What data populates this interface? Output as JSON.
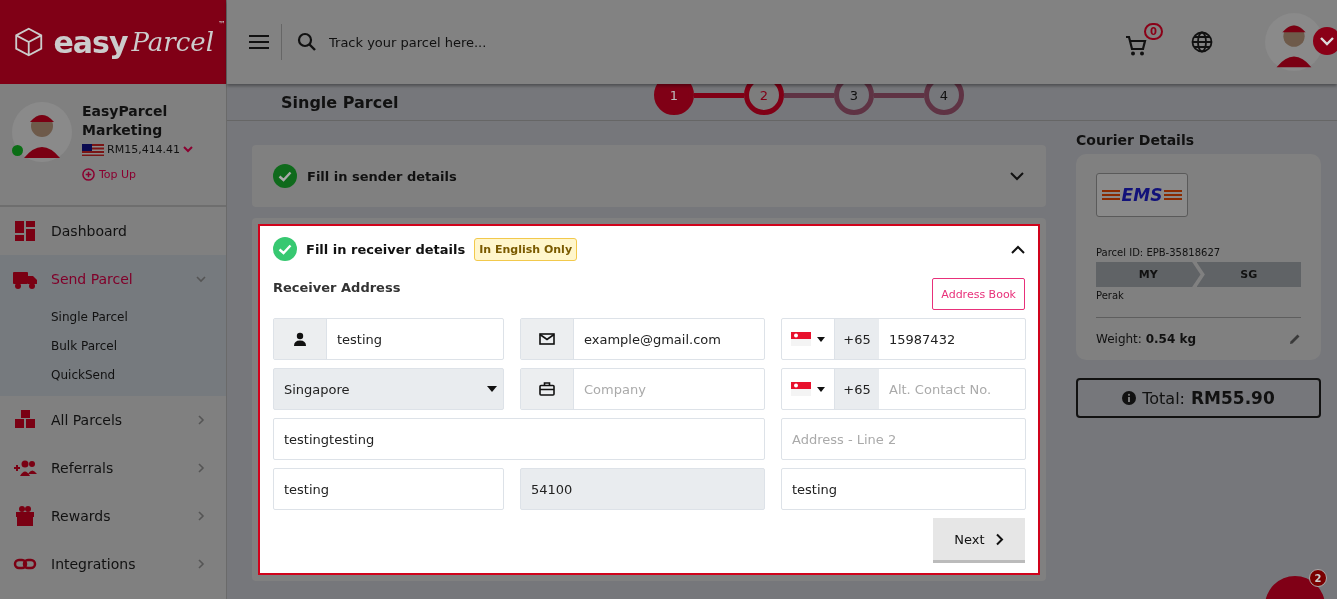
{
  "logo": {
    "word1": "easy",
    "word2": "Parcel",
    "tm": "™"
  },
  "topbar": {
    "search_placeholder": "Track your parcel here...",
    "cart_count": "0"
  },
  "user": {
    "name": "EasyParcel Marketing",
    "balance": "RM15,414.41",
    "online": true,
    "top_up": "Top Up"
  },
  "sidebar": [
    {
      "label": "Dashboard",
      "kind": "dashboard",
      "selected": false
    },
    {
      "label": "Send Parcel",
      "kind": "truck",
      "selected": true,
      "expanded": true,
      "children": [
        {
          "label": "Single Parcel"
        },
        {
          "label": "Bulk Parcel"
        },
        {
          "label": "QuickSend"
        }
      ]
    },
    {
      "label": "All Parcels",
      "kind": "boxes",
      "selected": false,
      "expanded": false
    },
    {
      "label": "Referrals",
      "kind": "people",
      "selected": false,
      "expanded": false
    },
    {
      "label": "Rewards",
      "kind": "gift",
      "selected": false,
      "expanded": false
    },
    {
      "label": "Integrations",
      "kind": "link",
      "selected": false,
      "expanded": false
    }
  ],
  "page": {
    "title": "Single Parcel",
    "steps": [
      {
        "label": "1",
        "completed": true,
        "selected": false
      },
      {
        "label": "2",
        "completed": false,
        "selected": true
      },
      {
        "label": "3",
        "completed": false,
        "selected": false
      },
      {
        "label": "4",
        "completed": false,
        "selected": false
      }
    ]
  },
  "sections": [
    {
      "title": "Fill in sender details",
      "completed": true,
      "expanded": false
    },
    {
      "title": "Fill in receiver details",
      "completed": true,
      "expanded": true,
      "badge": "In English Only",
      "subtitle": "Receiver Address",
      "address_book": "Address Book",
      "next": "Next",
      "rows": [
        [
          {
            "kind": "name",
            "value": "testing",
            "disabled": false
          },
          {
            "kind": "email",
            "value": "example@gmail.com",
            "disabled": false
          },
          {
            "kind": "phone",
            "code": "+65",
            "value": "15987432",
            "disabled": false
          }
        ],
        [
          {
            "kind": "country",
            "value": "Singapore"
          },
          {
            "kind": "company",
            "placeholder": "Company",
            "disabled": false
          },
          {
            "kind": "phone",
            "code": "+65",
            "placeholder": "Alt. Contact No.",
            "disabled": false
          }
        ],
        [
          {
            "kind": "text",
            "value": "testingtesting",
            "disabled": false
          },
          {
            "kind": "text",
            "placeholder": "Address - Line 2",
            "disabled": false
          }
        ],
        [
          {
            "kind": "text",
            "value": "testing",
            "disabled": false
          },
          {
            "kind": "text",
            "value": "54100",
            "disabled": true
          },
          {
            "kind": "text",
            "value": "testing",
            "disabled": false
          }
        ]
      ]
    }
  ],
  "courier": {
    "heading": "Courier Details",
    "logo": "EMS",
    "parcel_id": "Parcel ID: EPB-35818627",
    "from": "MY",
    "to": "SG",
    "from_state": "Perak",
    "weight_label": "Weight:",
    "weight": "0.54 kg",
    "total_label": "Total:",
    "total": "RM55.90"
  },
  "chat_badge": "2"
}
